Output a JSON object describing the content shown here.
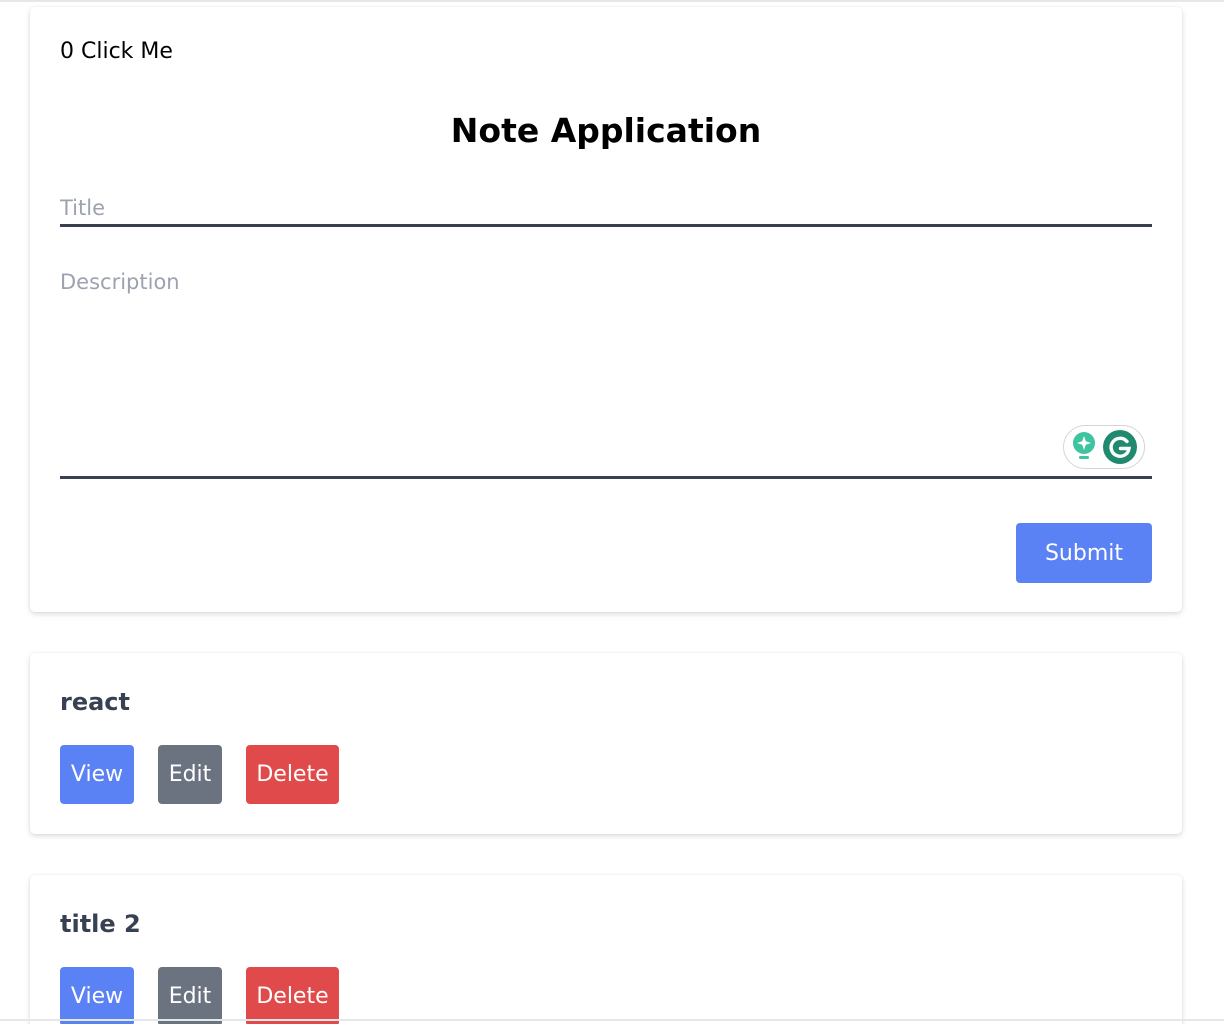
{
  "counter": {
    "count": "0",
    "label": "Click Me"
  },
  "app": {
    "title": "Note Application"
  },
  "form": {
    "title_placeholder": "Title",
    "title_value": "",
    "description_placeholder": "Description",
    "description_value": "",
    "submit_label": "Submit"
  },
  "grammarly": {
    "icons": [
      "lightbulb-icon",
      "grammarly-g-icon"
    ]
  },
  "notes": [
    {
      "title": "react",
      "view_label": "View",
      "edit_label": "Edit",
      "delete_label": "Delete"
    },
    {
      "title": "title 2",
      "view_label": "View",
      "edit_label": "Edit",
      "delete_label": "Delete"
    }
  ],
  "colors": {
    "primary": "#5b82f5",
    "secondary": "#6b7280",
    "danger": "#e14a4a",
    "input_border": "#374151",
    "note_title": "#374151",
    "grammarly_green": "#1f8a6f",
    "grammarly_teal": "#3fc3a1"
  }
}
